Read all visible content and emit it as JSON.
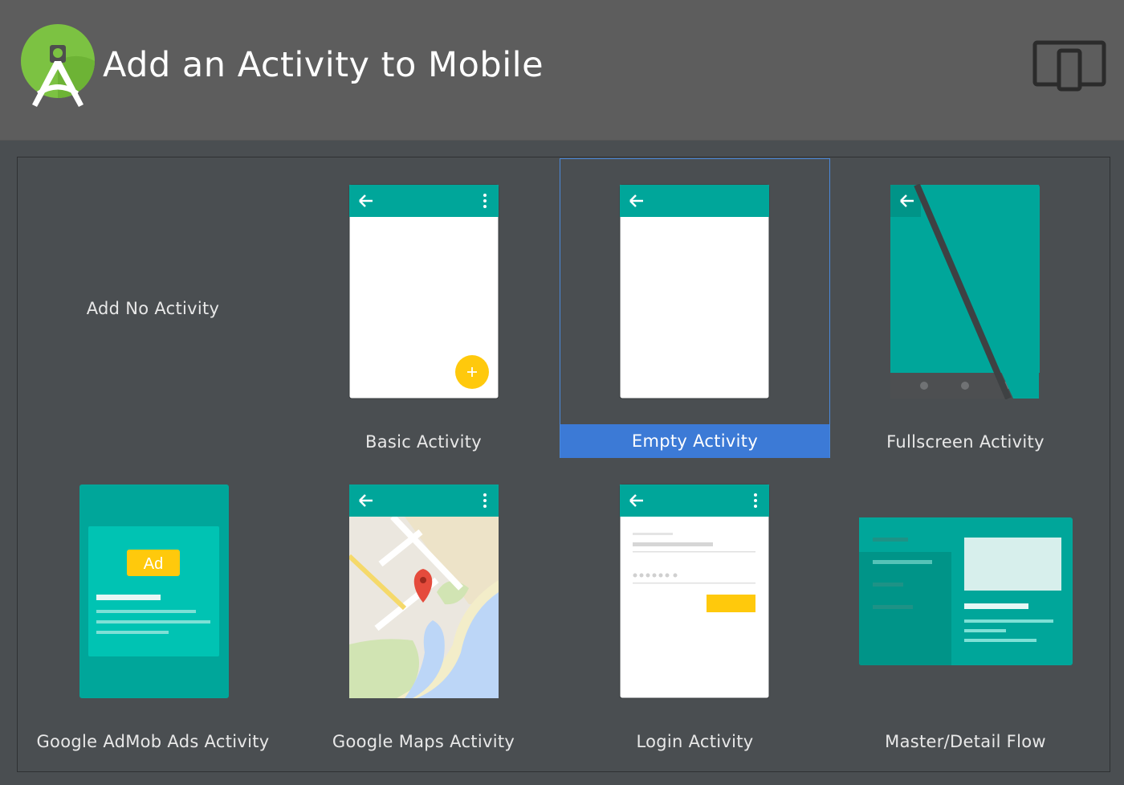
{
  "header": {
    "title": "Add an Activity to Mobile",
    "logo_icon": "android-studio-icon",
    "device_icon": "tablet-phone-icon"
  },
  "colors": {
    "header_bg": "#5d5d5d",
    "gallery_bg": "#4a4e51",
    "teal": "#00a69a",
    "selection": "#3c7ad6",
    "fab": "#ffc90c"
  },
  "templates": [
    {
      "label": "Add No Activity",
      "selected": false
    },
    {
      "label": "Basic Activity",
      "selected": false
    },
    {
      "label": "Empty Activity",
      "selected": true
    },
    {
      "label": "Fullscreen Activity",
      "selected": false
    },
    {
      "label": "Google AdMob Ads Activity",
      "selected": false,
      "badge": "Ad"
    },
    {
      "label": "Google Maps Activity",
      "selected": false
    },
    {
      "label": "Login Activity",
      "selected": false
    },
    {
      "label": "Master/Detail Flow",
      "selected": false
    }
  ]
}
